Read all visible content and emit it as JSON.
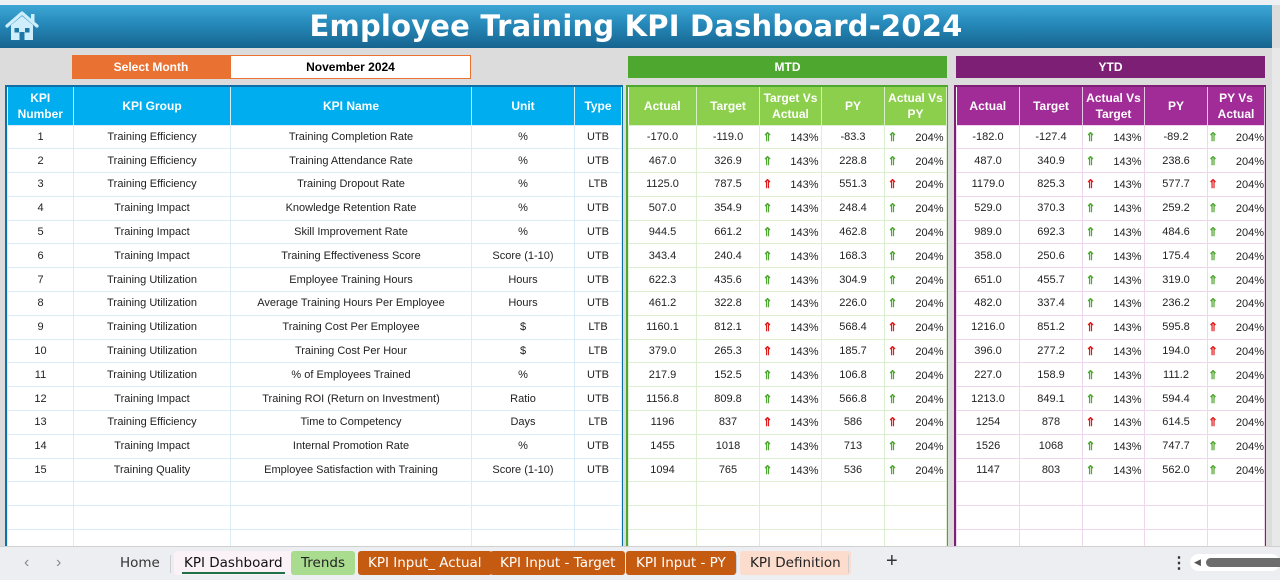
{
  "header": {
    "title": "Employee Training KPI Dashboard-2024",
    "home_icon": "home-icon"
  },
  "month_selector": {
    "label": "Select Month",
    "value": "November 2024"
  },
  "sections": {
    "mtd": "MTD",
    "ytd": "YTD"
  },
  "colors": {
    "title_bar": "#2588b8",
    "info_header": "#00aeef",
    "mtd_band": "#4ea72e",
    "mtd_header": "#8ccf4d",
    "ytd_band": "#7d1f74",
    "ytd_header": "#a12c98",
    "month_label": "#e97132",
    "good_arrow": "#4ea72e",
    "bad_arrow": "#e01b1b"
  },
  "info_columns": [
    "KPI Number",
    "KPI Group",
    "KPI Name",
    "Unit",
    "Type"
  ],
  "mtd_columns": [
    "Actual",
    "Target",
    "Target Vs Actual",
    "PY",
    "Actual Vs PY"
  ],
  "ytd_columns": [
    "Actual",
    "Target",
    "Actual Vs Target",
    "PY",
    "PY Vs Actual"
  ],
  "rows": [
    {
      "num": "1",
      "group": "Training Efficiency",
      "name": "Training Completion Rate",
      "unit": "%",
      "type": "UTB",
      "mtd": {
        "actual": "-170.0",
        "target": "-119.0",
        "tva": "143%",
        "tva_status": "good",
        "py": "-83.3",
        "avp": "204%",
        "avp_status": "good"
      },
      "ytd": {
        "actual": "-182.0",
        "target": "-127.4",
        "avt": "143%",
        "avt_status": "good",
        "py": "-89.2",
        "pva": "204%",
        "pva_status": "good"
      }
    },
    {
      "num": "2",
      "group": "Training Efficiency",
      "name": "Training Attendance Rate",
      "unit": "%",
      "type": "UTB",
      "mtd": {
        "actual": "467.0",
        "target": "326.9",
        "tva": "143%",
        "tva_status": "good",
        "py": "228.8",
        "avp": "204%",
        "avp_status": "good"
      },
      "ytd": {
        "actual": "487.0",
        "target": "340.9",
        "avt": "143%",
        "avt_status": "good",
        "py": "238.6",
        "pva": "204%",
        "pva_status": "good"
      }
    },
    {
      "num": "3",
      "group": "Training Efficiency",
      "name": "Training Dropout Rate",
      "unit": "%",
      "type": "LTB",
      "mtd": {
        "actual": "1125.0",
        "target": "787.5",
        "tva": "143%",
        "tva_status": "bad",
        "py": "551.3",
        "avp": "204%",
        "avp_status": "bad"
      },
      "ytd": {
        "actual": "1179.0",
        "target": "825.3",
        "avt": "143%",
        "avt_status": "bad",
        "py": "577.7",
        "pva": "204%",
        "pva_status": "bad"
      }
    },
    {
      "num": "4",
      "group": "Training Impact",
      "name": "Knowledge Retention Rate",
      "unit": "%",
      "type": "UTB",
      "mtd": {
        "actual": "507.0",
        "target": "354.9",
        "tva": "143%",
        "tva_status": "good",
        "py": "248.4",
        "avp": "204%",
        "avp_status": "good"
      },
      "ytd": {
        "actual": "529.0",
        "target": "370.3",
        "avt": "143%",
        "avt_status": "good",
        "py": "259.2",
        "pva": "204%",
        "pva_status": "good"
      }
    },
    {
      "num": "5",
      "group": "Training Impact",
      "name": "Skill Improvement Rate",
      "unit": "%",
      "type": "UTB",
      "mtd": {
        "actual": "944.5",
        "target": "661.2",
        "tva": "143%",
        "tva_status": "good",
        "py": "462.8",
        "avp": "204%",
        "avp_status": "good"
      },
      "ytd": {
        "actual": "989.0",
        "target": "692.3",
        "avt": "143%",
        "avt_status": "good",
        "py": "484.6",
        "pva": "204%",
        "pva_status": "good"
      }
    },
    {
      "num": "6",
      "group": "Training Impact",
      "name": "Training Effectiveness Score",
      "unit": "Score (1-10)",
      "type": "UTB",
      "mtd": {
        "actual": "343.4",
        "target": "240.4",
        "tva": "143%",
        "tva_status": "good",
        "py": "168.3",
        "avp": "204%",
        "avp_status": "good"
      },
      "ytd": {
        "actual": "358.0",
        "target": "250.6",
        "avt": "143%",
        "avt_status": "good",
        "py": "175.4",
        "pva": "204%",
        "pva_status": "good"
      }
    },
    {
      "num": "7",
      "group": "Training Utilization",
      "name": "Employee Training Hours",
      "unit": "Hours",
      "type": "UTB",
      "mtd": {
        "actual": "622.3",
        "target": "435.6",
        "tva": "143%",
        "tva_status": "good",
        "py": "304.9",
        "avp": "204%",
        "avp_status": "good"
      },
      "ytd": {
        "actual": "651.0",
        "target": "455.7",
        "avt": "143%",
        "avt_status": "good",
        "py": "319.0",
        "pva": "204%",
        "pva_status": "good"
      }
    },
    {
      "num": "8",
      "group": "Training Utilization",
      "name": "Average Training Hours Per Employee",
      "unit": "Hours",
      "type": "UTB",
      "mtd": {
        "actual": "461.2",
        "target": "322.8",
        "tva": "143%",
        "tva_status": "good",
        "py": "226.0",
        "avp": "204%",
        "avp_status": "good"
      },
      "ytd": {
        "actual": "482.0",
        "target": "337.4",
        "avt": "143%",
        "avt_status": "good",
        "py": "236.2",
        "pva": "204%",
        "pva_status": "good"
      }
    },
    {
      "num": "9",
      "group": "Training Utilization",
      "name": "Training Cost Per Employee",
      "unit": "$",
      "type": "LTB",
      "mtd": {
        "actual": "1160.1",
        "target": "812.1",
        "tva": "143%",
        "tva_status": "bad",
        "py": "568.4",
        "avp": "204%",
        "avp_status": "bad"
      },
      "ytd": {
        "actual": "1216.0",
        "target": "851.2",
        "avt": "143%",
        "avt_status": "bad",
        "py": "595.8",
        "pva": "204%",
        "pva_status": "bad"
      }
    },
    {
      "num": "10",
      "group": "Training Utilization",
      "name": "Training Cost Per Hour",
      "unit": "$",
      "type": "LTB",
      "mtd": {
        "actual": "379.0",
        "target": "265.3",
        "tva": "143%",
        "tva_status": "bad",
        "py": "185.7",
        "avp": "204%",
        "avp_status": "bad"
      },
      "ytd": {
        "actual": "396.0",
        "target": "277.2",
        "avt": "143%",
        "avt_status": "bad",
        "py": "194.0",
        "pva": "204%",
        "pva_status": "bad"
      }
    },
    {
      "num": "11",
      "group": "Training Utilization",
      "name": "% of Employees Trained",
      "unit": "%",
      "type": "UTB",
      "mtd": {
        "actual": "217.9",
        "target": "152.5",
        "tva": "143%",
        "tva_status": "good",
        "py": "106.8",
        "avp": "204%",
        "avp_status": "good"
      },
      "ytd": {
        "actual": "227.0",
        "target": "158.9",
        "avt": "143%",
        "avt_status": "good",
        "py": "111.2",
        "pva": "204%",
        "pva_status": "good"
      }
    },
    {
      "num": "12",
      "group": "Training Impact",
      "name": "Training ROI (Return on Investment)",
      "unit": "Ratio",
      "type": "UTB",
      "mtd": {
        "actual": "1156.8",
        "target": "809.8",
        "tva": "143%",
        "tva_status": "good",
        "py": "566.8",
        "avp": "204%",
        "avp_status": "good"
      },
      "ytd": {
        "actual": "1213.0",
        "target": "849.1",
        "avt": "143%",
        "avt_status": "good",
        "py": "594.4",
        "pva": "204%",
        "pva_status": "good"
      }
    },
    {
      "num": "13",
      "group": "Training Efficiency",
      "name": "Time to Competency",
      "unit": "Days",
      "type": "LTB",
      "mtd": {
        "actual": "1196",
        "target": "837",
        "tva": "143%",
        "tva_status": "bad",
        "py": "586",
        "avp": "204%",
        "avp_status": "bad"
      },
      "ytd": {
        "actual": "1254",
        "target": "878",
        "avt": "143%",
        "avt_status": "bad",
        "py": "614.5",
        "pva": "204%",
        "pva_status": "bad"
      }
    },
    {
      "num": "14",
      "group": "Training Impact",
      "name": "Internal Promotion Rate",
      "unit": "%",
      "type": "UTB",
      "mtd": {
        "actual": "1455",
        "target": "1018",
        "tva": "143%",
        "tva_status": "good",
        "py": "713",
        "avp": "204%",
        "avp_status": "good"
      },
      "ytd": {
        "actual": "1526",
        "target": "1068",
        "avt": "143%",
        "avt_status": "good",
        "py": "747.7",
        "pva": "204%",
        "pva_status": "good"
      }
    },
    {
      "num": "15",
      "group": "Training Quality",
      "name": "Employee Satisfaction with Training",
      "unit": "Score (1-10)",
      "type": "UTB",
      "mtd": {
        "actual": "1094",
        "target": "765",
        "tva": "143%",
        "tva_status": "good",
        "py": "536",
        "avp": "204%",
        "avp_status": "good"
      },
      "ytd": {
        "actual": "1147",
        "target": "803",
        "avt": "143%",
        "avt_status": "good",
        "py": "562.0",
        "pva": "204%",
        "pva_status": "good"
      }
    }
  ],
  "arrow_glyph": "⇑",
  "sheet_tabs": [
    {
      "label": "Home",
      "style": "home"
    },
    {
      "label": "KPI Dashboard",
      "style": "active"
    },
    {
      "label": "Trends",
      "style": "trends"
    },
    {
      "label": "KPI Input_ Actual",
      "style": "orange"
    },
    {
      "label": "KPI Input - Target",
      "style": "orange"
    },
    {
      "label": "KPI Input - PY",
      "style": "orange"
    },
    {
      "label": "KPI Definition",
      "style": "peach"
    }
  ],
  "tabbar": {
    "prev": "‹",
    "next": "›",
    "add": "+",
    "more": "⋮"
  }
}
